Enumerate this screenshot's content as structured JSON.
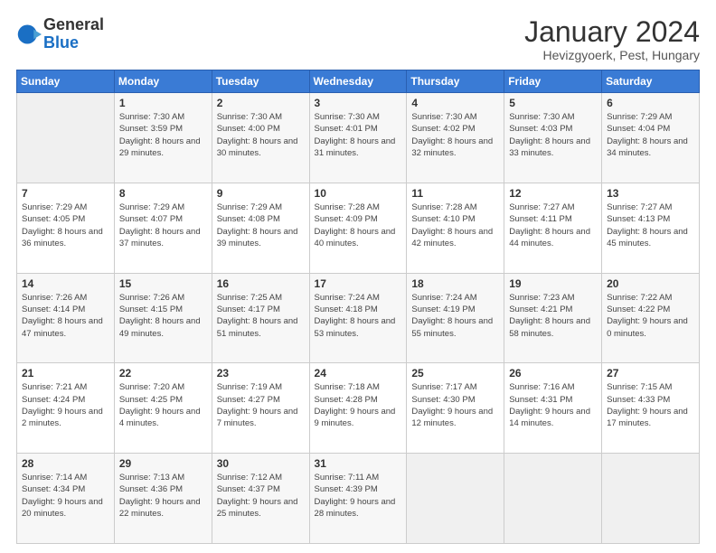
{
  "header": {
    "logo_general": "General",
    "logo_blue": "Blue",
    "title": "January 2024",
    "subtitle": "Hevizgyoerk, Pest, Hungary"
  },
  "weekdays": [
    "Sunday",
    "Monday",
    "Tuesday",
    "Wednesday",
    "Thursday",
    "Friday",
    "Saturday"
  ],
  "weeks": [
    [
      {
        "day": "",
        "sunrise": "",
        "sunset": "",
        "daylight": ""
      },
      {
        "day": "1",
        "sunrise": "7:30 AM",
        "sunset": "3:59 PM",
        "daylight": "8 hours and 29 minutes."
      },
      {
        "day": "2",
        "sunrise": "7:30 AM",
        "sunset": "4:00 PM",
        "daylight": "8 hours and 30 minutes."
      },
      {
        "day": "3",
        "sunrise": "7:30 AM",
        "sunset": "4:01 PM",
        "daylight": "8 hours and 31 minutes."
      },
      {
        "day": "4",
        "sunrise": "7:30 AM",
        "sunset": "4:02 PM",
        "daylight": "8 hours and 32 minutes."
      },
      {
        "day": "5",
        "sunrise": "7:30 AM",
        "sunset": "4:03 PM",
        "daylight": "8 hours and 33 minutes."
      },
      {
        "day": "6",
        "sunrise": "7:29 AM",
        "sunset": "4:04 PM",
        "daylight": "8 hours and 34 minutes."
      }
    ],
    [
      {
        "day": "7",
        "sunrise": "7:29 AM",
        "sunset": "4:05 PM",
        "daylight": "8 hours and 36 minutes."
      },
      {
        "day": "8",
        "sunrise": "7:29 AM",
        "sunset": "4:07 PM",
        "daylight": "8 hours and 37 minutes."
      },
      {
        "day": "9",
        "sunrise": "7:29 AM",
        "sunset": "4:08 PM",
        "daylight": "8 hours and 39 minutes."
      },
      {
        "day": "10",
        "sunrise": "7:28 AM",
        "sunset": "4:09 PM",
        "daylight": "8 hours and 40 minutes."
      },
      {
        "day": "11",
        "sunrise": "7:28 AM",
        "sunset": "4:10 PM",
        "daylight": "8 hours and 42 minutes."
      },
      {
        "day": "12",
        "sunrise": "7:27 AM",
        "sunset": "4:11 PM",
        "daylight": "8 hours and 44 minutes."
      },
      {
        "day": "13",
        "sunrise": "7:27 AM",
        "sunset": "4:13 PM",
        "daylight": "8 hours and 45 minutes."
      }
    ],
    [
      {
        "day": "14",
        "sunrise": "7:26 AM",
        "sunset": "4:14 PM",
        "daylight": "8 hours and 47 minutes."
      },
      {
        "day": "15",
        "sunrise": "7:26 AM",
        "sunset": "4:15 PM",
        "daylight": "8 hours and 49 minutes."
      },
      {
        "day": "16",
        "sunrise": "7:25 AM",
        "sunset": "4:17 PM",
        "daylight": "8 hours and 51 minutes."
      },
      {
        "day": "17",
        "sunrise": "7:24 AM",
        "sunset": "4:18 PM",
        "daylight": "8 hours and 53 minutes."
      },
      {
        "day": "18",
        "sunrise": "7:24 AM",
        "sunset": "4:19 PM",
        "daylight": "8 hours and 55 minutes."
      },
      {
        "day": "19",
        "sunrise": "7:23 AM",
        "sunset": "4:21 PM",
        "daylight": "8 hours and 58 minutes."
      },
      {
        "day": "20",
        "sunrise": "7:22 AM",
        "sunset": "4:22 PM",
        "daylight": "9 hours and 0 minutes."
      }
    ],
    [
      {
        "day": "21",
        "sunrise": "7:21 AM",
        "sunset": "4:24 PM",
        "daylight": "9 hours and 2 minutes."
      },
      {
        "day": "22",
        "sunrise": "7:20 AM",
        "sunset": "4:25 PM",
        "daylight": "9 hours and 4 minutes."
      },
      {
        "day": "23",
        "sunrise": "7:19 AM",
        "sunset": "4:27 PM",
        "daylight": "9 hours and 7 minutes."
      },
      {
        "day": "24",
        "sunrise": "7:18 AM",
        "sunset": "4:28 PM",
        "daylight": "9 hours and 9 minutes."
      },
      {
        "day": "25",
        "sunrise": "7:17 AM",
        "sunset": "4:30 PM",
        "daylight": "9 hours and 12 minutes."
      },
      {
        "day": "26",
        "sunrise": "7:16 AM",
        "sunset": "4:31 PM",
        "daylight": "9 hours and 14 minutes."
      },
      {
        "day": "27",
        "sunrise": "7:15 AM",
        "sunset": "4:33 PM",
        "daylight": "9 hours and 17 minutes."
      }
    ],
    [
      {
        "day": "28",
        "sunrise": "7:14 AM",
        "sunset": "4:34 PM",
        "daylight": "9 hours and 20 minutes."
      },
      {
        "day": "29",
        "sunrise": "7:13 AM",
        "sunset": "4:36 PM",
        "daylight": "9 hours and 22 minutes."
      },
      {
        "day": "30",
        "sunrise": "7:12 AM",
        "sunset": "4:37 PM",
        "daylight": "9 hours and 25 minutes."
      },
      {
        "day": "31",
        "sunrise": "7:11 AM",
        "sunset": "4:39 PM",
        "daylight": "9 hours and 28 minutes."
      },
      {
        "day": "",
        "sunrise": "",
        "sunset": "",
        "daylight": ""
      },
      {
        "day": "",
        "sunrise": "",
        "sunset": "",
        "daylight": ""
      },
      {
        "day": "",
        "sunrise": "",
        "sunset": "",
        "daylight": ""
      }
    ]
  ]
}
